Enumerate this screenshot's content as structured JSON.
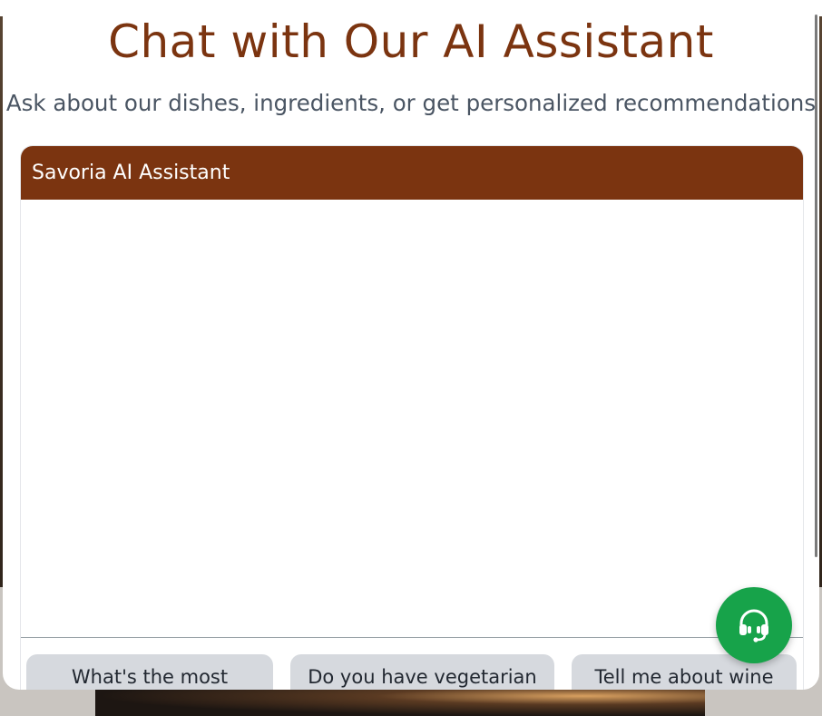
{
  "page": {
    "title": "Chat with Our AI Assistant",
    "subtitle": "Ask about our dishes, ingredients, or get personalized recommendations"
  },
  "chat": {
    "header_title": "Savoria AI Assistant",
    "messages": [],
    "suggestions": [
      "What's the most",
      "Do you have vegetarian",
      "Tell me about wine"
    ]
  },
  "support_button": {
    "icon": "headset-icon"
  },
  "colors": {
    "brand": "#7b3410",
    "subtitle": "#4a5563",
    "suggestion_bg": "#d6d9de",
    "fab": "#17a34a"
  }
}
